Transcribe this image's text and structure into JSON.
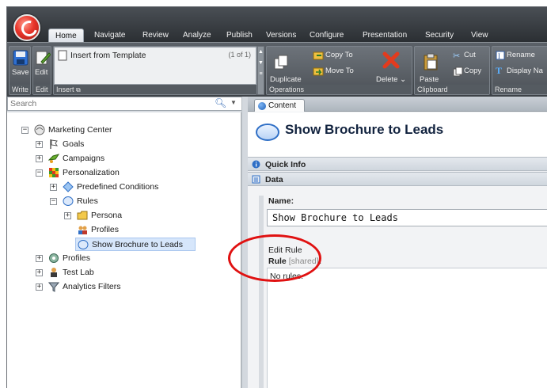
{
  "ribbon": {
    "tabs": [
      "Home",
      "Navigate",
      "Review",
      "Analyze",
      "Publish",
      "Versions",
      "Configure",
      "Presentation",
      "Security",
      "View"
    ],
    "active_tab": "Home",
    "groups": {
      "write": {
        "label": "Write",
        "save_label": "Save"
      },
      "edit": {
        "label": "Edit",
        "edit_label": "Edit"
      },
      "insert": {
        "label": "Insert",
        "template_item": "Insert from Template",
        "count": "(1 of 1)"
      },
      "operations": {
        "label": "Operations",
        "duplicate": "Duplicate",
        "copy_to": "Copy To",
        "move_to": "Move To",
        "delete": "Delete"
      },
      "clipboard": {
        "label": "Clipboard",
        "paste": "Paste",
        "cut": "Cut",
        "copy": "Copy"
      },
      "rename": {
        "label": "Rename",
        "rename": "Rename",
        "display_name": "Display Na"
      }
    }
  },
  "search": {
    "placeholder": "Search"
  },
  "tree": {
    "marketing_center": "Marketing Center",
    "goals": "Goals",
    "campaigns": "Campaigns",
    "personalization": "Personalization",
    "predefined_conditions": "Predefined Conditions",
    "rules": "Rules",
    "persona": "Persona",
    "profiles_child": "Profiles",
    "show_brochure": "Show Brochure to Leads",
    "profiles": "Profiles",
    "test_lab": "Test Lab",
    "analytics_filters": "Analytics Filters"
  },
  "content": {
    "tab_label": "Content",
    "title": "Show Brochure to Leads",
    "quick_info": "Quick Info",
    "data_section": "Data",
    "name_label": "Name:",
    "name_value": "Show Brochure to Leads",
    "edit_rule": "Edit Rule",
    "rule_label": "Rule",
    "rule_shared": "[shared]",
    "rule_colon": ":",
    "rule_value": "No rules."
  },
  "colors": {
    "annotation": "#e01111",
    "accent": "#2f6fc6"
  }
}
